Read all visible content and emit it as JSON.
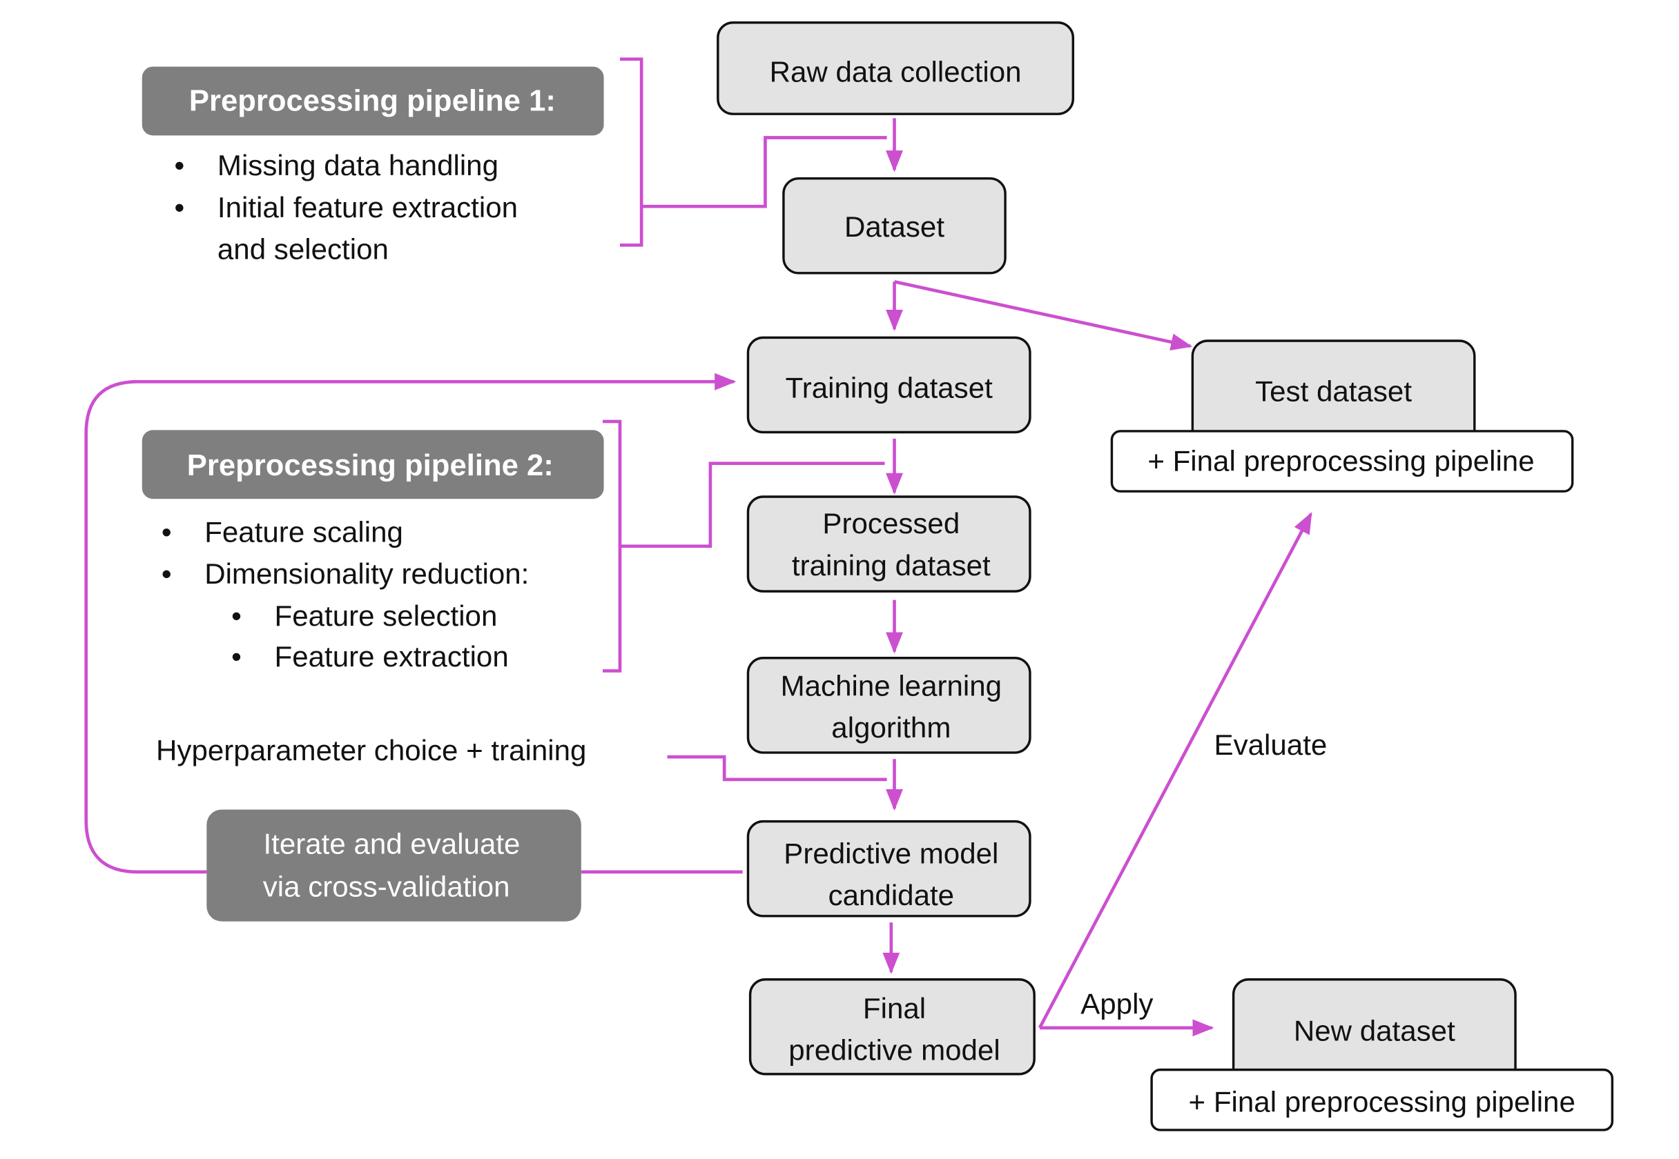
{
  "colors": {
    "connector": "#cc4fd0",
    "box_fill": "#e3e3e3",
    "dark_box_fill": "#7f7f7f"
  },
  "nodes": {
    "raw_data": "Raw data collection",
    "dataset": "Dataset",
    "training_dataset": "Training dataset",
    "test_dataset": "Test dataset",
    "test_pipeline": "+ Final preprocessing pipeline",
    "processed_1": "Processed",
    "processed_2": "training dataset",
    "ml_1": "Machine learning",
    "ml_2": "algorithm",
    "candidate_1": "Predictive model",
    "candidate_2": "candidate",
    "final_1": "Final",
    "final_2": "predictive model",
    "new_dataset": "New dataset",
    "new_pipeline": "+ Final preprocessing pipeline"
  },
  "pipeline1": {
    "title": "Preprocessing  pipeline 1:",
    "items": [
      "Missing data handling",
      "Initial feature extraction",
      "and selection"
    ]
  },
  "pipeline2": {
    "title": "Preprocessing pipeline 2:",
    "items": [
      "Feature scaling",
      "Dimensionality reduction:",
      "Feature selection",
      "Feature extraction"
    ]
  },
  "labels": {
    "hyperparameter": "Hyperparameter choice + training",
    "iterate_1": "Iterate and evaluate",
    "iterate_2": "via cross-validation",
    "evaluate": "Evaluate",
    "apply": "Apply"
  },
  "bullet": "•"
}
